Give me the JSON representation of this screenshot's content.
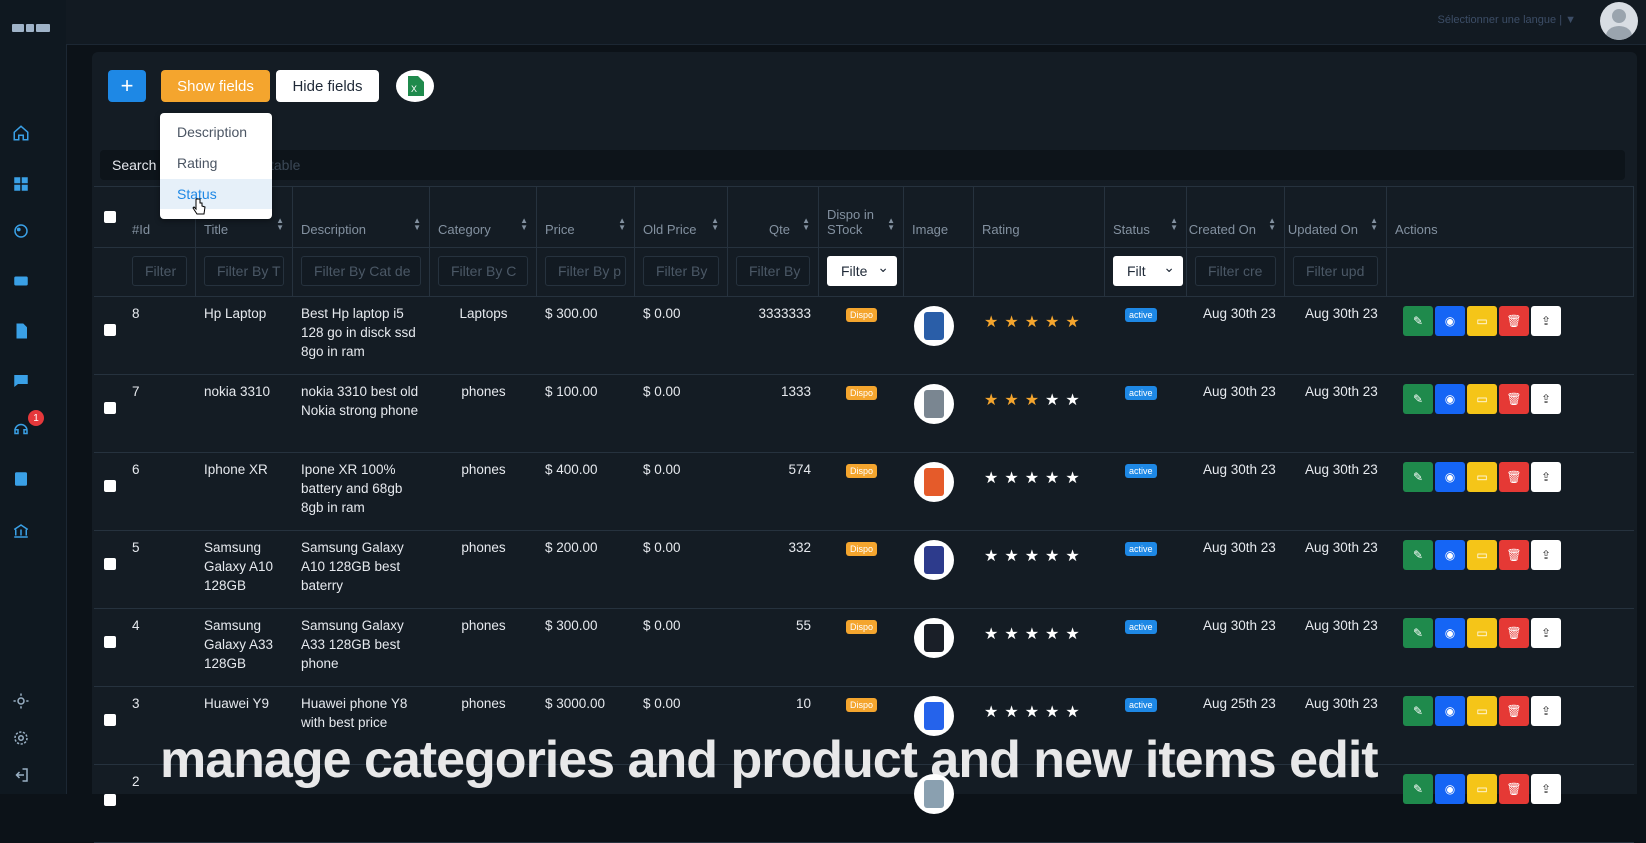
{
  "topbar": {
    "language_label": "Sélectionner une langue | ▼"
  },
  "toolbar": {
    "add_label": "+",
    "show_label": "Show fields",
    "hide_label": "Hide fields"
  },
  "dropdown": {
    "items": [
      "Description",
      "Rating",
      "Status"
    ]
  },
  "search": {
    "label": "Search",
    "placeholder": "table"
  },
  "badge_count": "1",
  "columns": [
    "#Id",
    "Title",
    "Description",
    "Category",
    "Price",
    "Old Price",
    "Qte",
    "Dispo in STock",
    "Image",
    "Rating",
    "Status",
    "Created On",
    "Updated On",
    "Actions"
  ],
  "filters": [
    "Filter",
    "Filter By T",
    "Filter By Cat de",
    "Filter By C",
    "Filter By p",
    "Filter By",
    "Filter By",
    "Filte",
    "Filt",
    "Filter cre",
    "Filter upd"
  ],
  "rows": [
    {
      "id": "8",
      "title": "Hp Laptop",
      "desc": "Best Hp laptop i5 128 go in disck ssd 8go in ram",
      "category": "Laptops",
      "price": "$ 300.00",
      "old_price": "$ 0.00",
      "qte": "3333333",
      "dispo": "Dispo",
      "rating": 5,
      "status": "active",
      "created": "Aug 30th 23",
      "updated": "Aug 30th 23"
    },
    {
      "id": "7",
      "title": "nokia 3310",
      "desc": "nokia 3310 best old Nokia strong phone",
      "category": "phones",
      "price": "$ 100.00",
      "old_price": "$ 0.00",
      "qte": "1333",
      "dispo": "Dispo",
      "rating": 3,
      "status": "active",
      "created": "Aug 30th 23",
      "updated": "Aug 30th 23"
    },
    {
      "id": "6",
      "title": "Iphone XR",
      "desc": "Ipone XR 100% battery and 68gb 8gb in ram",
      "category": "phones",
      "price": "$ 400.00",
      "old_price": "$ 0.00",
      "qte": "574",
      "dispo": "Dispo",
      "rating": 0,
      "status": "active",
      "created": "Aug 30th 23",
      "updated": "Aug 30th 23"
    },
    {
      "id": "5",
      "title": "Samsung Galaxy A10 128GB",
      "desc": "Samsung Galaxy A10 128GB best baterry",
      "category": "phones",
      "price": "$ 200.00",
      "old_price": "$ 0.00",
      "qte": "332",
      "dispo": "Dispo",
      "rating": 0,
      "status": "active",
      "created": "Aug 30th 23",
      "updated": "Aug 30th 23"
    },
    {
      "id": "4",
      "title": "Samsung Galaxy A33 128GB",
      "desc": "Samsung Galaxy A33 128GB best phone",
      "category": "phones",
      "price": "$ 300.00",
      "old_price": "$ 0.00",
      "qte": "55",
      "dispo": "Dispo",
      "rating": 0,
      "status": "active",
      "created": "Aug 30th 23",
      "updated": "Aug 30th 23"
    },
    {
      "id": "3",
      "title": "Huawei Y9",
      "desc": "Huawei phone Y8 with best price",
      "category": "phones",
      "price": "$ 3000.00",
      "old_price": "$ 0.00",
      "qte": "10",
      "dispo": "Dispo",
      "rating": 0,
      "status": "active",
      "created": "Aug 25th 23",
      "updated": "Aug 30th 23"
    },
    {
      "id": "2",
      "title": "",
      "desc": "",
      "category": "",
      "price": "",
      "old_price": "",
      "qte": "",
      "dispo": "",
      "rating": 0,
      "status": "",
      "created": "",
      "updated": ""
    }
  ],
  "caption": "manage categories and product and new items edit",
  "colors": {
    "accent": "#1e88e5",
    "warning": "#f4a52e",
    "star": "#f4a52e"
  }
}
